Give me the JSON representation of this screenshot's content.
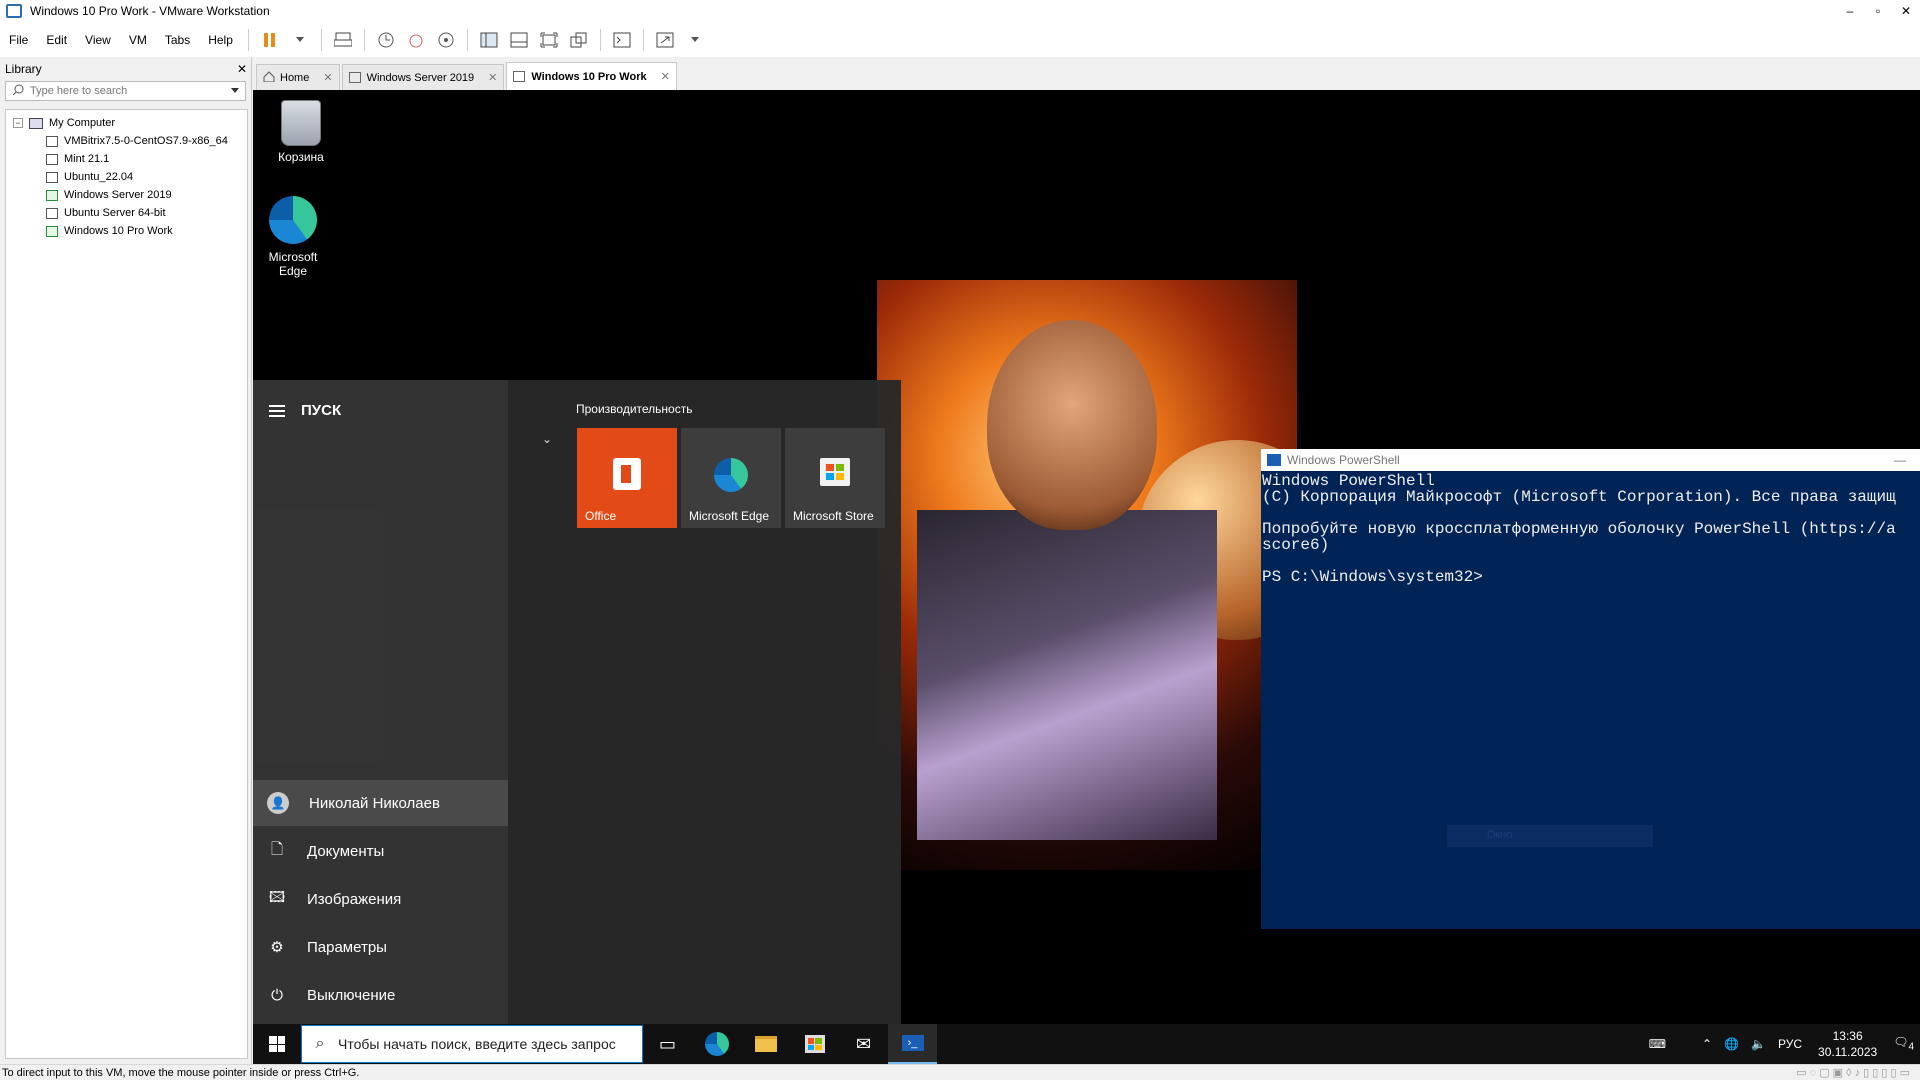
{
  "window": {
    "title": "Windows 10 Pro Work - VMware Workstation",
    "controls": [
      "–",
      "▫",
      "✕"
    ]
  },
  "menu": [
    "File",
    "Edit",
    "View",
    "VM",
    "Tabs",
    "Help"
  ],
  "library": {
    "title": "Library",
    "close": "✕",
    "search_placeholder": "Type here to search",
    "root": "My Computer",
    "vms": [
      {
        "name": "VMBitrix7.5-0-CentOS7.9-x86_64",
        "running": false
      },
      {
        "name": "Mint 21.1",
        "running": false
      },
      {
        "name": "Ubuntu_22.04",
        "running": false
      },
      {
        "name": "Windows Server 2019",
        "running": true
      },
      {
        "name": "Ubuntu Server 64-bit",
        "running": false
      },
      {
        "name": "Windows 10 Pro Work",
        "running": true
      }
    ]
  },
  "tabs": [
    {
      "label": "Home",
      "close": "✕"
    },
    {
      "label": "Windows Server 2019",
      "close": "✕"
    },
    {
      "label": "Windows 10 Pro Work",
      "close": "✕",
      "active": true
    }
  ],
  "desktop": {
    "icons": [
      "Корзина",
      "Microsoft Edge"
    ]
  },
  "start_menu": {
    "title": "ПУСК",
    "user": "Николай Николаев",
    "items": [
      "Документы",
      "Изображения",
      "Параметры",
      "Выключение"
    ],
    "group_title": "Производительность",
    "tiles": [
      "Office",
      "Microsoft Edge",
      "Microsoft Store"
    ]
  },
  "powershell": {
    "title": "Windows PowerShell",
    "lines": [
      "Windows PowerShell",
      "(C) Корпорация Майкрософт (Microsoft Corporation). Все права защищ",
      "",
      "Попробуйте новую кроссплатформенную оболочку PowerShell (https://a",
      "score6)",
      "",
      "PS C:\\Windows\\system32>"
    ],
    "ghost": "Окно"
  },
  "taskbar": {
    "search_placeholder": "Чтобы начать поиск, введите здесь запрос",
    "lang": "РУС",
    "time": "13:36",
    "date": "30.11.2023",
    "notif_count": "4"
  },
  "status": "To direct input to this VM, move the mouse pointer inside or press Ctrl+G.",
  "colors": {
    "accent": "#0078d7",
    "office": "#e24a17",
    "ps_bg": "#012456"
  }
}
